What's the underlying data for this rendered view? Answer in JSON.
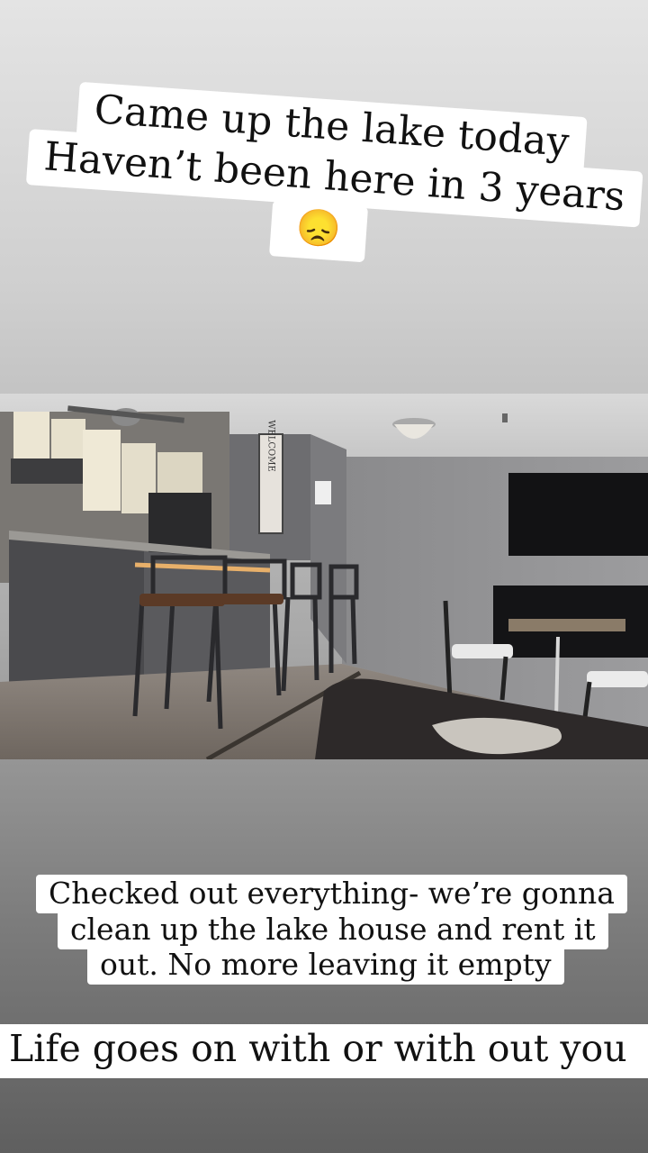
{
  "story": {
    "caption_top": {
      "line1": "Came up the lake today",
      "line2": "Haven’t been here in 3 years",
      "emoji": "😞"
    },
    "caption_middle": {
      "line1": "Checked out everything- we’re gonna",
      "line2": "clean up the lake house and rent it",
      "line3": "out. No more leaving it empty"
    },
    "caption_bottom": "Life goes on with or with out you",
    "photo": {
      "sign_text": "WELCOME"
    }
  }
}
